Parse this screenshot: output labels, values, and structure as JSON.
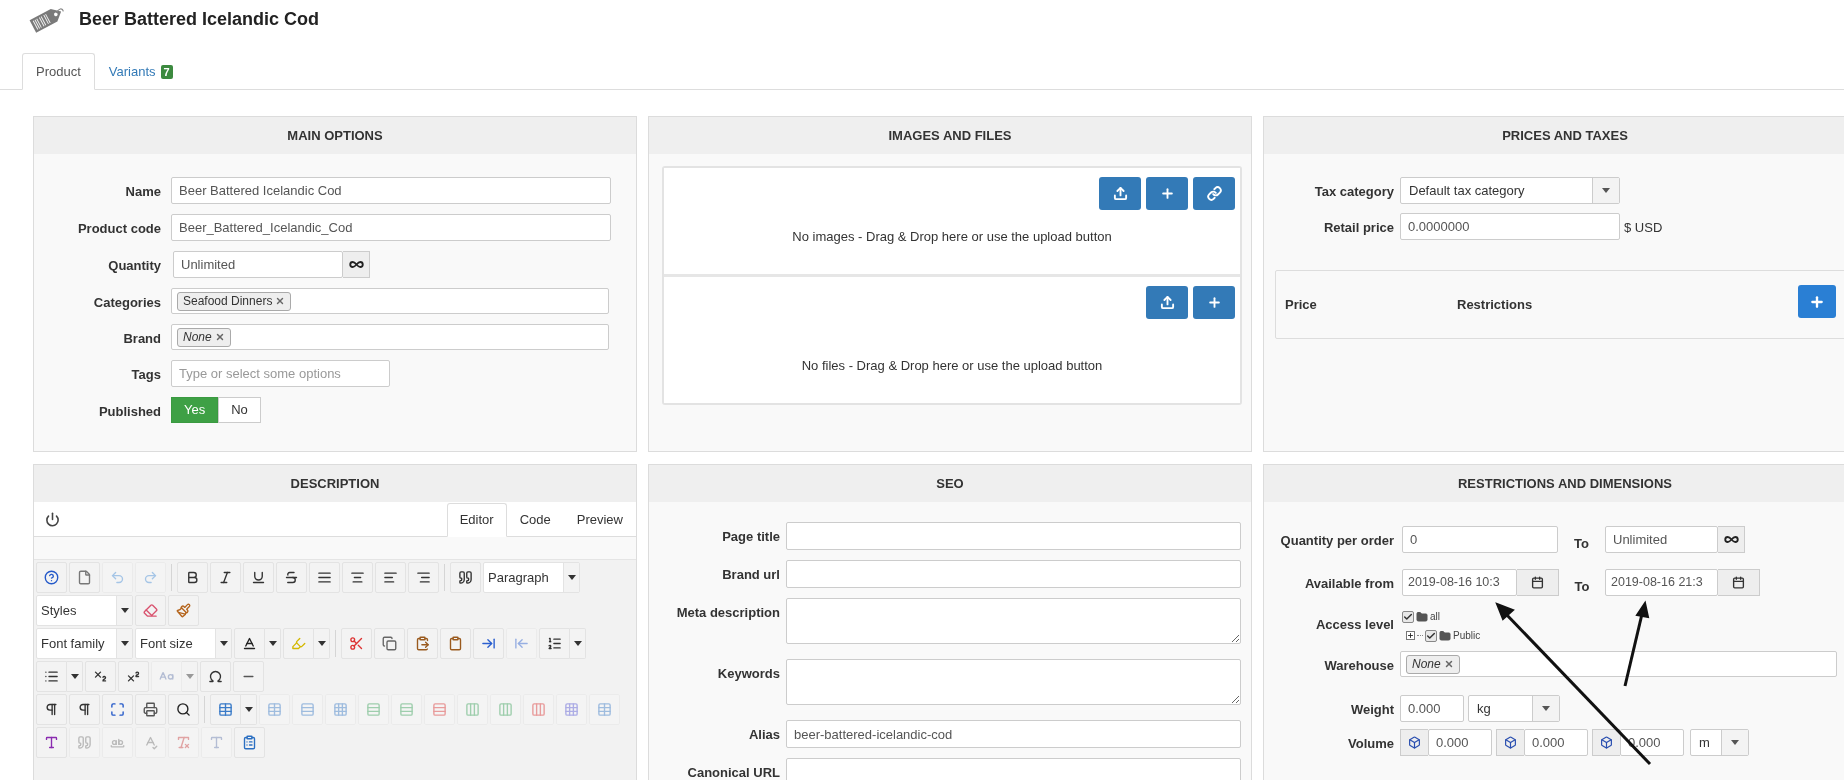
{
  "header": {
    "title": "Beer Battered Icelandic Cod"
  },
  "tabs": [
    {
      "label": "Product",
      "selected": true
    },
    {
      "label": "Variants",
      "badge": "7",
      "selected": false
    }
  ],
  "main_options": {
    "title": "MAIN OPTIONS",
    "fields": [
      {
        "kind": "text",
        "label": "Name",
        "value": "Beer Battered Icelandic Cod"
      },
      {
        "kind": "text",
        "label": "Product code",
        "value": "Beer_Battered_Icelandic_Cod"
      },
      {
        "kind": "unlimited",
        "label": "Quantity",
        "value": "Unlimited"
      },
      {
        "kind": "tags",
        "label": "Categories",
        "tags": [
          {
            "label": "Seafood Dinners",
            "italic": false
          }
        ]
      },
      {
        "kind": "tags",
        "label": "Brand",
        "tags": [
          {
            "label": "None",
            "italic": true
          }
        ]
      },
      {
        "kind": "tag_input",
        "label": "Tags",
        "placeholder": "Type or select some options"
      },
      {
        "kind": "toggle",
        "label": "Published",
        "options": [
          {
            "label": "Yes",
            "selected": true
          },
          {
            "label": "No",
            "selected": false
          }
        ]
      }
    ]
  },
  "images_and_files": {
    "title": "IMAGES AND FILES",
    "dropzones": [
      {
        "message": "No images - Drag & Drop here or use the upload button",
        "buttons": [
          {
            "kind": "upload"
          },
          {
            "kind": "add"
          },
          {
            "kind": "link"
          }
        ]
      },
      {
        "message": "No files - Drag & Drop here or use the upload button",
        "buttons": [
          {
            "kind": "upload"
          },
          {
            "kind": "add"
          }
        ]
      }
    ]
  },
  "prices_and_taxes": {
    "title": "PRICES AND TAXES",
    "tax_category": {
      "label": "Tax category",
      "value": "Default tax category"
    },
    "retail_price": {
      "label": "Retail price",
      "value": "0.0000000",
      "suffix": "$ USD"
    },
    "price_table": {
      "columns": [
        "Price",
        "Restrictions"
      ]
    }
  },
  "description": {
    "title": "DESCRIPTION",
    "tabs": [
      {
        "label": "Editor",
        "selected": true
      },
      {
        "label": "Code",
        "selected": false
      },
      {
        "label": "Preview",
        "selected": false
      }
    ],
    "toolbar": [
      [
        {
          "kind": "button",
          "disabled": false
        },
        {
          "kind": "button",
          "disabled": false
        },
        {
          "kind": "button",
          "disabled": true
        },
        {
          "kind": "button",
          "disabled": true
        },
        {
          "kind": "separator"
        },
        {
          "kind": "button",
          "disabled": false
        },
        {
          "kind": "button",
          "disabled": false
        },
        {
          "kind": "button",
          "disabled": false
        },
        {
          "kind": "button",
          "disabled": false
        },
        {
          "kind": "button",
          "disabled": false
        },
        {
          "kind": "button",
          "disabled": false
        },
        {
          "kind": "button",
          "disabled": false
        },
        {
          "kind": "button",
          "disabled": false
        },
        {
          "kind": "separator"
        },
        {
          "kind": "button",
          "disabled": false
        },
        {
          "kind": "select",
          "label": "Paragraph"
        }
      ],
      [
        {
          "kind": "select",
          "label": "Styles"
        },
        {
          "kind": "button",
          "disabled": false
        },
        {
          "kind": "button",
          "disabled": false
        }
      ],
      [
        {
          "kind": "select",
          "label": "Font family"
        },
        {
          "kind": "select",
          "label": "Font size"
        },
        {
          "kind": "split",
          "disabled": false
        },
        {
          "kind": "split",
          "disabled": false
        },
        {
          "kind": "separator"
        },
        {
          "kind": "button",
          "disabled": false
        },
        {
          "kind": "button",
          "disabled": false
        },
        {
          "kind": "button",
          "disabled": false
        },
        {
          "kind": "button",
          "disabled": false
        },
        {
          "kind": "button",
          "disabled": false
        },
        {
          "kind": "button",
          "disabled": true
        },
        {
          "kind": "split",
          "disabled": false
        }
      ],
      [
        {
          "kind": "split",
          "disabled": false
        },
        {
          "kind": "button",
          "disabled": false
        },
        {
          "kind": "button",
          "disabled": false
        },
        {
          "kind": "split",
          "disabled": true
        },
        {
          "kind": "button",
          "disabled": false
        },
        {
          "kind": "button",
          "disabled": false
        }
      ],
      [
        {
          "kind": "button",
          "disabled": false
        },
        {
          "kind": "button",
          "disabled": false
        },
        {
          "kind": "button",
          "disabled": false
        },
        {
          "kind": "button",
          "disabled": false
        },
        {
          "kind": "button",
          "disabled": false
        },
        {
          "kind": "separator"
        },
        {
          "kind": "split",
          "disabled": false
        },
        {
          "kind": "button",
          "disabled": true
        },
        {
          "kind": "button",
          "disabled": true
        },
        {
          "kind": "button",
          "disabled": true
        },
        {
          "kind": "button",
          "disabled": true
        },
        {
          "kind": "button",
          "disabled": true
        },
        {
          "kind": "button",
          "disabled": true
        },
        {
          "kind": "button",
          "disabled": true
        },
        {
          "kind": "button",
          "disabled": true
        },
        {
          "kind": "button",
          "disabled": true
        },
        {
          "kind": "button",
          "disabled": true
        },
        {
          "kind": "button",
          "disabled": true
        }
      ],
      [
        {
          "kind": "button",
          "disabled": false
        },
        {
          "kind": "button",
          "disabled": true
        },
        {
          "kind": "button",
          "disabled": true
        },
        {
          "kind": "button",
          "disabled": true
        },
        {
          "kind": "button",
          "disabled": true
        },
        {
          "kind": "button",
          "disabled": true
        },
        {
          "kind": "button",
          "disabled": false
        }
      ]
    ]
  },
  "seo": {
    "title": "SEO",
    "fields": [
      {
        "kind": "input",
        "label": "Page title"
      },
      {
        "kind": "input",
        "label": "Brand url"
      },
      {
        "kind": "textarea",
        "label": "Meta description"
      },
      {
        "kind": "textarea",
        "label": "Keywords"
      },
      {
        "kind": "input",
        "label": "Alias",
        "value": "beer-battered-icelandic-cod"
      },
      {
        "kind": "input",
        "label": "Canonical URL"
      }
    ]
  },
  "restrictions": {
    "title": "RESTRICTIONS AND DIMENSIONS",
    "quantity": {
      "label": "Quantity per order",
      "from": "0",
      "to_label": "To",
      "to": "Unlimited"
    },
    "available": {
      "label": "Available from",
      "from": "2019-08-16 10:3",
      "to_label": "To",
      "to": "2019-08-16 21:3"
    },
    "access_level": {
      "label": "Access level",
      "tree": [
        {
          "label": "all",
          "checked": true,
          "children": [
            {
              "label": "Public",
              "checked": true,
              "expanded": false
            }
          ]
        }
      ]
    },
    "warehouse": {
      "label": "Warehouse",
      "tags": [
        {
          "label": "None",
          "italic": true
        }
      ]
    },
    "weight": {
      "label": "Weight",
      "value": "0.000",
      "unit": "kg"
    },
    "volume": {
      "label": "Volume",
      "values": [
        "0.000",
        "0.000",
        "0.000"
      ],
      "unit": "m"
    }
  }
}
